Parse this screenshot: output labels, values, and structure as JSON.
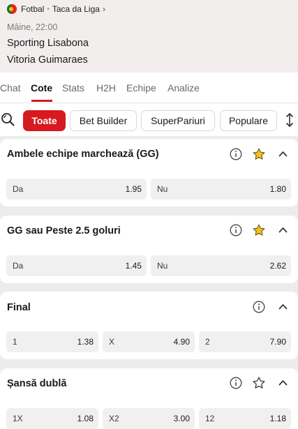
{
  "match": {
    "sport": "Fotbal",
    "competition": "Taca da Liga",
    "time": "Mâine, 22:00",
    "home": "Sporting Lisabona",
    "away": "Vitoria Guimaraes"
  },
  "tabs": [
    {
      "label": "Chat",
      "active": false
    },
    {
      "label": "Cote",
      "active": true
    },
    {
      "label": "Stats",
      "active": false
    },
    {
      "label": "H2H",
      "active": false
    },
    {
      "label": "Echipe",
      "active": false
    },
    {
      "label": "Analize",
      "active": false
    }
  ],
  "filters": [
    "Toate",
    "Bet Builder",
    "SuperPariuri",
    "Populare"
  ],
  "markets": [
    {
      "title": "Ambele echipe marchează (GG)",
      "favorite": true,
      "odds": [
        {
          "label": "Da",
          "value": "1.95"
        },
        {
          "label": "Nu",
          "value": "1.80"
        }
      ]
    },
    {
      "title": "GG sau Peste 2.5 goluri",
      "favorite": true,
      "odds": [
        {
          "label": "Da",
          "value": "1.45"
        },
        {
          "label": "Nu",
          "value": "2.62"
        }
      ]
    },
    {
      "title": "Final",
      "odds": [
        {
          "label": "1",
          "value": "1.38"
        },
        {
          "label": "X",
          "value": "4.90"
        },
        {
          "label": "2",
          "value": "7.90"
        }
      ]
    },
    {
      "title": "Șansă dublă",
      "favorite": false,
      "odds": [
        {
          "label": "1X",
          "value": "1.08"
        },
        {
          "label": "X2",
          "value": "3.00"
        },
        {
          "label": "12",
          "value": "1.18"
        }
      ]
    }
  ],
  "colors": {
    "accent": "#d71920",
    "star": "#f2c418"
  },
  "icons": [
    "search-icon",
    "sort-icon",
    "info-icon",
    "star-icon",
    "chevron-up-icon",
    "chevron-right-icon"
  ]
}
